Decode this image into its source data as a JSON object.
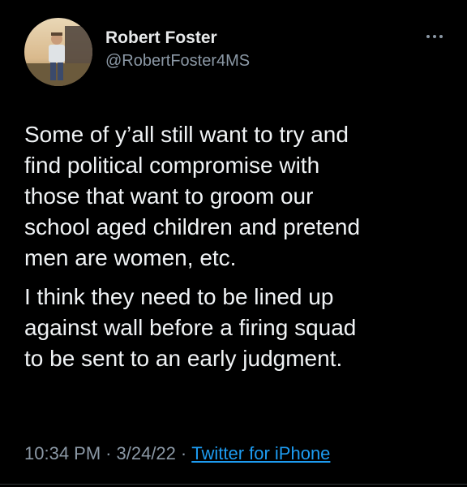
{
  "author": {
    "display_name": "Robert Foster",
    "handle": "@RobertFoster4MS",
    "avatar_icon": "profile-photo"
  },
  "menu": {
    "icon": "more-horizontal-icon"
  },
  "tweet": {
    "paragraphs": [
      "Some of y’all still want to try and\nfind political compromise with\nthose that want to groom our\nschool aged children and pretend\nmen are women, etc.",
      "I think they need to be lined up\nagainst  wall before a firing squad\nto be sent to an early judgment."
    ]
  },
  "meta": {
    "time": "10:34 PM",
    "date": "3/24/22",
    "separator": "·",
    "source": "Twitter for iPhone"
  },
  "colors": {
    "background": "#000000",
    "text": "#e7e9ea",
    "secondary": "#8b98a5",
    "link": "#1d9bf0"
  }
}
